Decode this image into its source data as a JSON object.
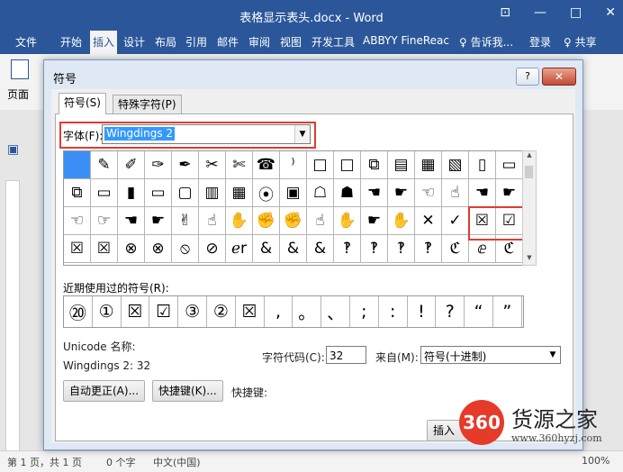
{
  "window": {
    "title": "表格显示表头.docx - Word",
    "minimize": "—",
    "maximize": "□",
    "close": "✕",
    "restore": "⊡"
  },
  "ribbon_tabs": [
    "文件",
    "开始",
    "插入",
    "设计",
    "布局",
    "引用",
    "邮件",
    "审阅",
    "视图",
    "开发工具",
    "ABBYY FineReac",
    "♀ 告诉我...",
    "登录",
    "♀ 共享"
  ],
  "ribbon": {
    "page_label": "页面"
  },
  "dialog": {
    "title": "符号",
    "help": "?",
    "close": "✕",
    "tabs": [
      "符号(S)",
      "特殊字符(P)"
    ],
    "font_label": "字体(F):",
    "font_value": "Wingdings 2",
    "symbols": [
      "",
      "✎",
      "✐",
      "✑",
      "✒",
      "✂",
      "✄",
      "☎",
      "⁾",
      "□",
      "□",
      "⧉",
      "▤",
      "▦",
      "▧",
      "▯",
      "▭",
      "⧉",
      "▭",
      "▮",
      "▭",
      "▢",
      "▥",
      "▦",
      "⦿",
      "▣",
      "☖",
      "☗",
      "☚",
      "☛",
      "☜",
      "☝",
      "☚",
      "☛",
      "☜",
      "☞",
      "☚",
      "☛",
      "✌",
      "☝",
      "✋",
      "✊",
      "✊",
      "☝",
      "✋",
      "☛",
      "✋",
      "✕",
      "✓",
      "☒",
      "☑",
      "☒",
      "☒",
      "⊗",
      "⊗",
      "⦸",
      "⊘",
      "ℯr",
      "&",
      "&",
      "&",
      "‽",
      "‽",
      "‽",
      "‽",
      "ℭ",
      "ⅇ",
      "ℭ"
    ],
    "recent_label": "近期使用过的符号(R):",
    "recent": [
      "⑳",
      "①",
      "☒",
      "☑",
      "③",
      "②",
      "☒",
      ",",
      "。",
      "、",
      ";",
      ":",
      "!",
      "?",
      "“",
      "”",
      "("
    ],
    "unicode_name_label": "Unicode 名称:",
    "unicode_name_value": "Wingdings 2: 32",
    "char_code_label": "字符代码(C):",
    "char_code_value": "32",
    "from_label": "来自(M):",
    "from_value": "符号(十进制)",
    "autocorrect_button": "自动更正(A)...",
    "shortcut_button": "快捷键(K)...",
    "shortcut_label": "快捷键:",
    "insert_button": "插入"
  },
  "status": {
    "page": "第 1 页，共 1 页",
    "words": "0 个字",
    "lang": "中文(中国)",
    "zoom": "100%"
  },
  "watermark": {
    "logo": "360",
    "name": "货源之家",
    "url": "www.360hyzj.com"
  }
}
